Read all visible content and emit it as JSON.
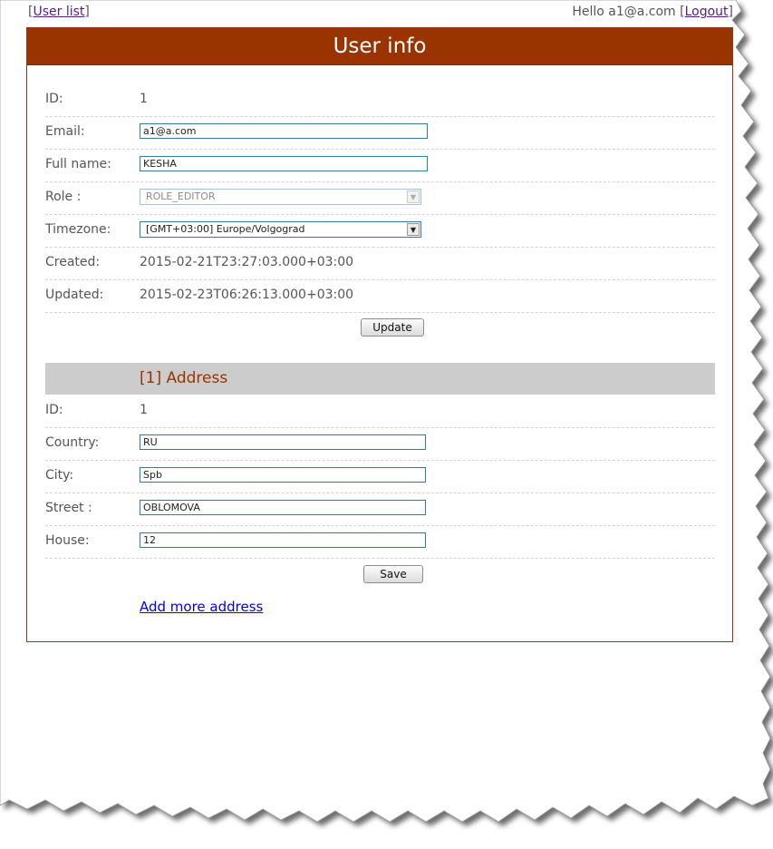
{
  "topbar": {
    "user_list_link": "User list",
    "greeting": "Hello a1@a.com",
    "logout_link": "Logout"
  },
  "panel": {
    "title": "User info"
  },
  "user": {
    "id_label": "ID:",
    "id_value": "1",
    "email_label": "Email:",
    "email_value": "a1@a.com",
    "fullname_label": "Full name:",
    "fullname_value": "KESHA",
    "role_label": "Role :",
    "role_value": "ROLE_EDITOR",
    "timezone_label": "Timezone:",
    "timezone_value": "[GMT+03:00] Europe/Volgograd",
    "created_label": "Created:",
    "created_value": "2015-02-21T23:27:03.000+03:00",
    "updated_label": "Updated:",
    "updated_value": "2015-02-23T06:26:13.000+03:00",
    "update_button": "Update"
  },
  "address": {
    "header": "[1] Address",
    "id_label": "ID:",
    "id_value": "1",
    "country_label": "Country:",
    "country_value": "RU",
    "city_label": "City:",
    "city_value": "Spb",
    "street_label": "Street :",
    "street_value": "OBLOMOVA",
    "house_label": "House:",
    "house_value": "12",
    "save_button": "Save"
  },
  "add_more_link": "Add more address",
  "colors": {
    "header_bg": "#993300",
    "address_header_text": "#993300",
    "address_header_bg": "#cccccc",
    "input_border": "#2e7d9a"
  },
  "icons": {
    "select_arrow": "chevron-down-icon"
  }
}
